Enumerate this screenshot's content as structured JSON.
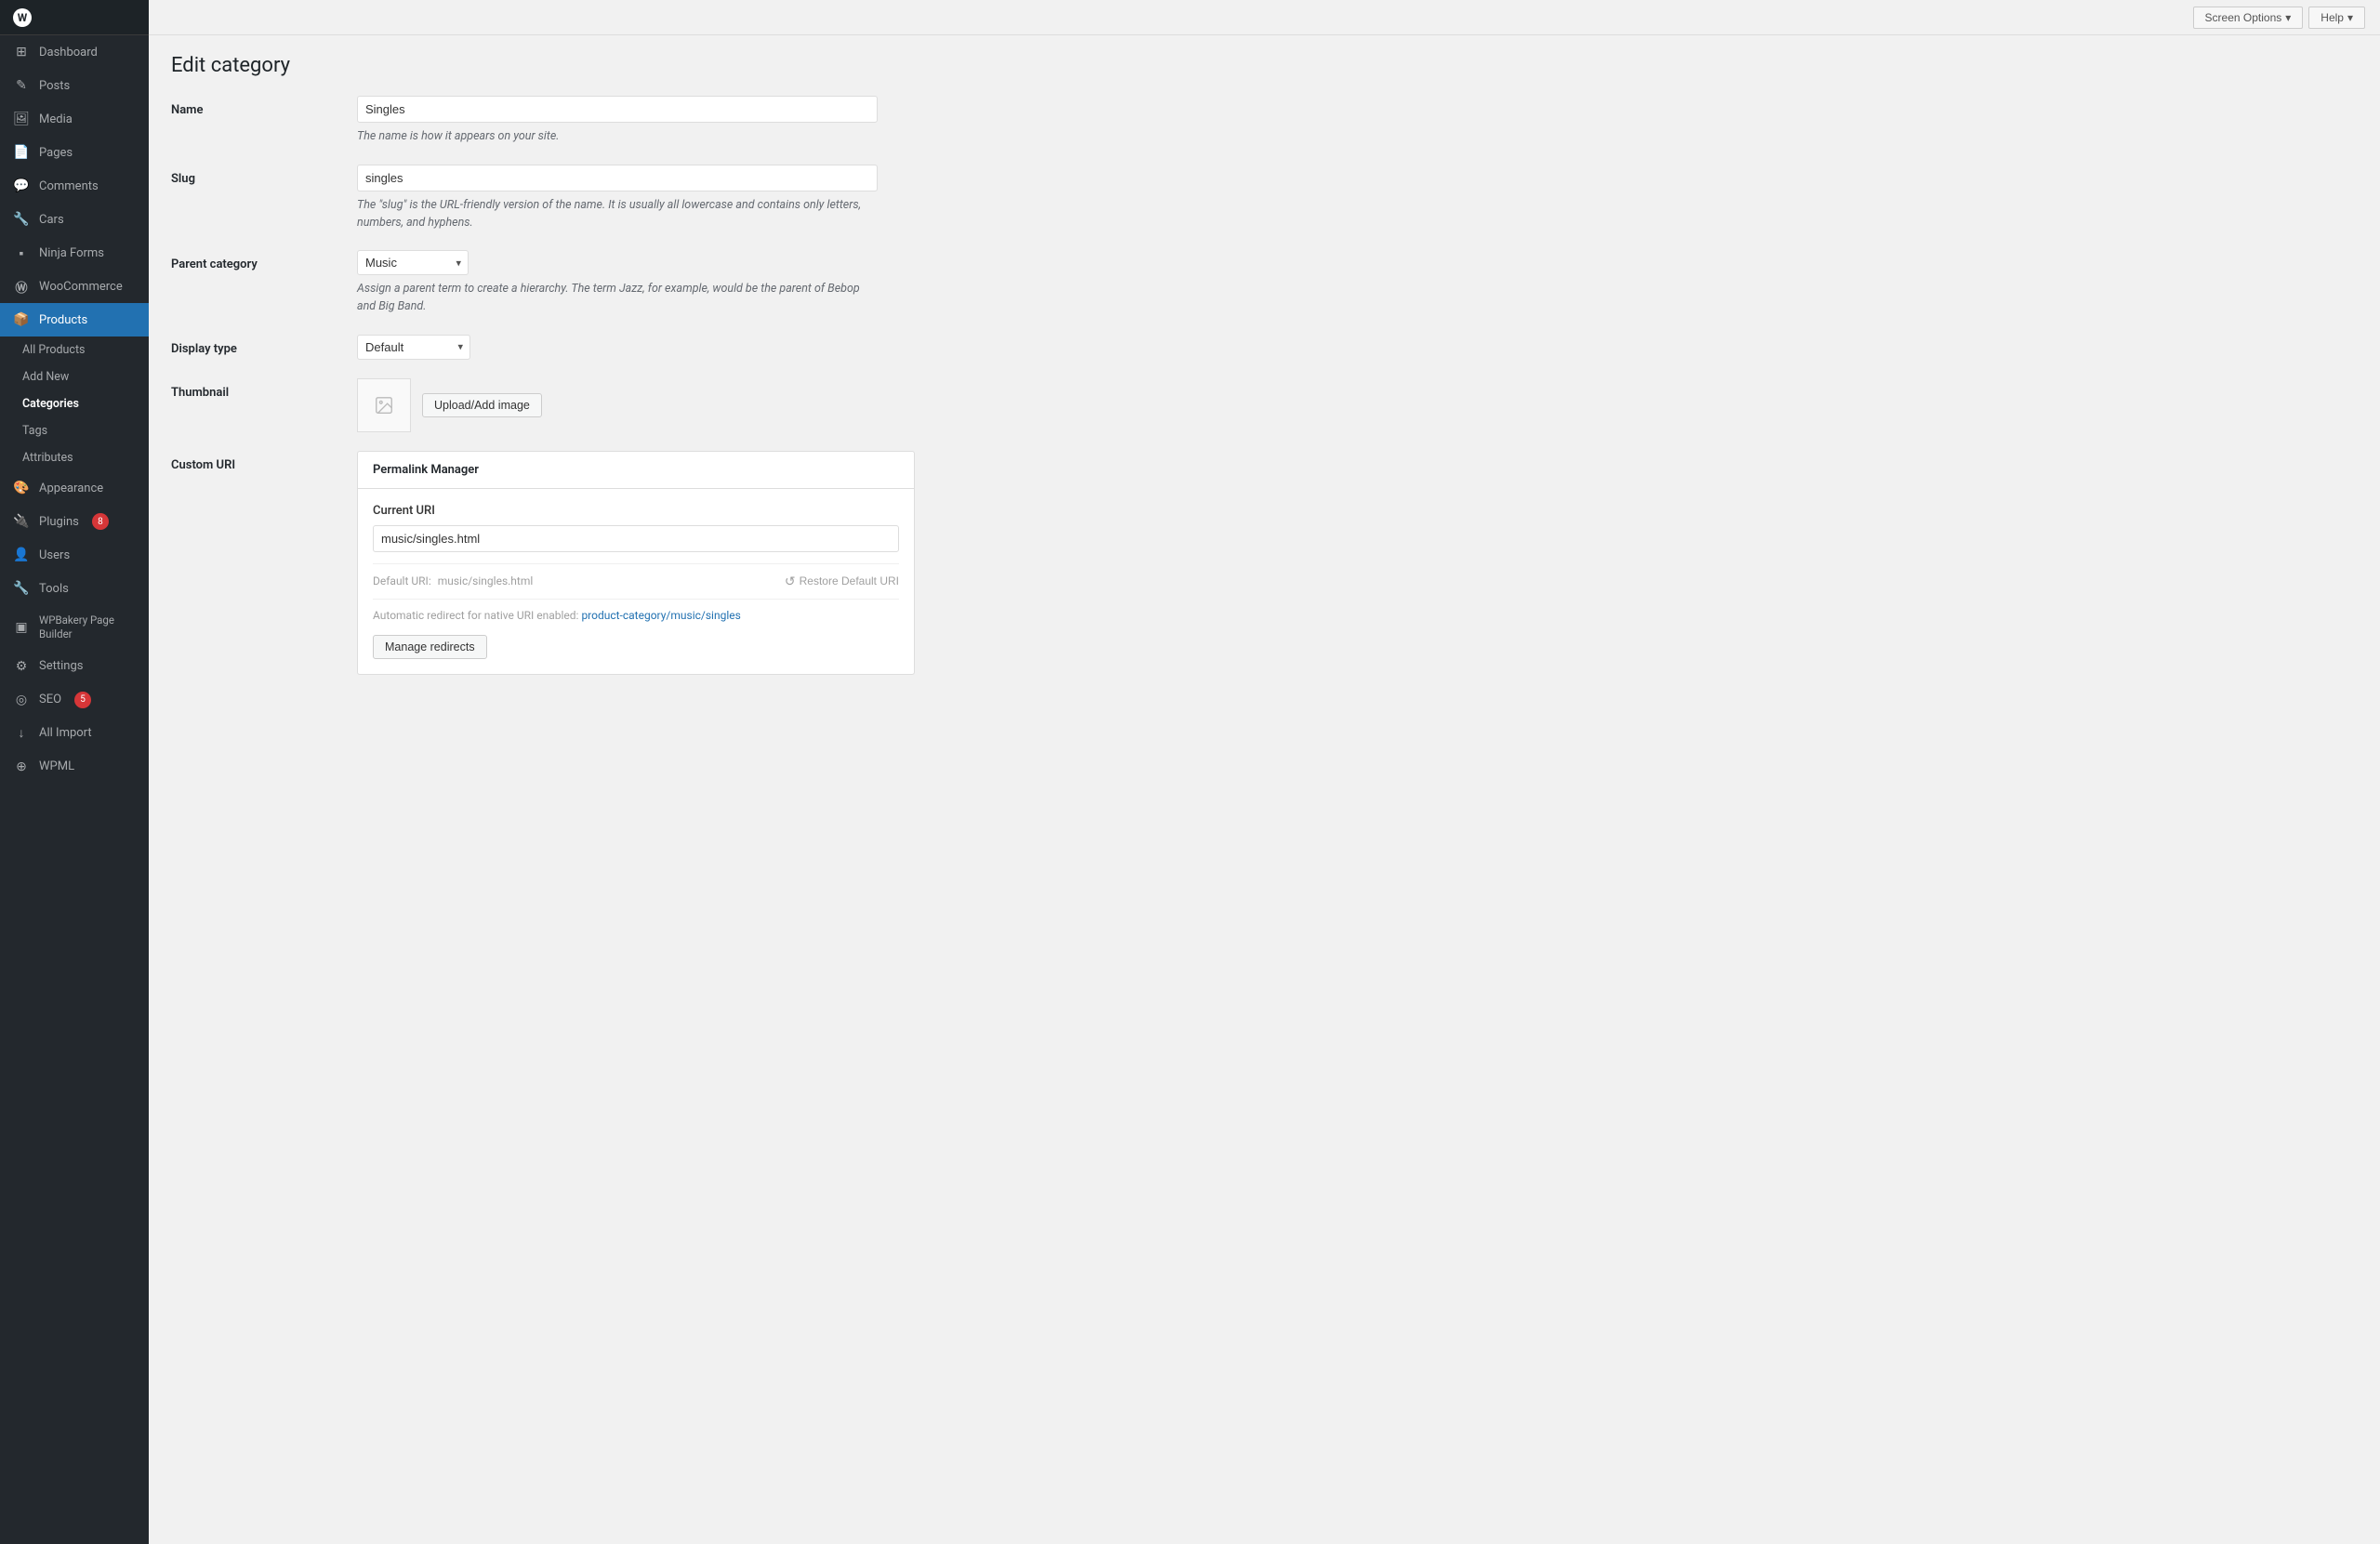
{
  "topbar": {
    "screen_options_label": "Screen Options",
    "help_label": "Help"
  },
  "sidebar": {
    "logo": "W",
    "items": [
      {
        "id": "dashboard",
        "label": "Dashboard",
        "icon": "⊞"
      },
      {
        "id": "posts",
        "label": "Posts",
        "icon": "✎"
      },
      {
        "id": "media",
        "label": "Media",
        "icon": "⊟"
      },
      {
        "id": "pages",
        "label": "Pages",
        "icon": "▬"
      },
      {
        "id": "comments",
        "label": "Comments",
        "icon": "💬"
      },
      {
        "id": "cars",
        "label": "Cars",
        "icon": "🔧"
      },
      {
        "id": "ninja-forms",
        "label": "Ninja Forms",
        "icon": "▪"
      },
      {
        "id": "woocommerce",
        "label": "WooCommerce",
        "icon": "Ⓦ"
      },
      {
        "id": "products",
        "label": "Products",
        "icon": "📦",
        "active": true
      },
      {
        "id": "appearance",
        "label": "Appearance",
        "icon": "🎨"
      },
      {
        "id": "plugins",
        "label": "Plugins",
        "icon": "🔌",
        "badge": "8"
      },
      {
        "id": "users",
        "label": "Users",
        "icon": "👤"
      },
      {
        "id": "tools",
        "label": "Tools",
        "icon": "🔧"
      },
      {
        "id": "wpbakery",
        "label": "WPBakery Page Builder",
        "icon": "▣"
      },
      {
        "id": "settings",
        "label": "Settings",
        "icon": "⚙"
      },
      {
        "id": "seo",
        "label": "SEO",
        "icon": "◎",
        "badge": "5"
      },
      {
        "id": "all-import",
        "label": "All Import",
        "icon": "↓"
      },
      {
        "id": "wpml",
        "label": "WPML",
        "icon": "⊕"
      }
    ],
    "subitems": [
      {
        "id": "all-products",
        "label": "All Products"
      },
      {
        "id": "add-new",
        "label": "Add New"
      },
      {
        "id": "categories",
        "label": "Categories",
        "active": true
      },
      {
        "id": "tags",
        "label": "Tags"
      },
      {
        "id": "attributes",
        "label": "Attributes"
      }
    ]
  },
  "page": {
    "title": "Edit category",
    "form": {
      "name_label": "Name",
      "name_value": "Singles",
      "name_hint": "The name is how it appears on your site.",
      "slug_label": "Slug",
      "slug_value": "singles",
      "slug_hint": "The \"slug\" is the URL-friendly version of the name. It is usually all lowercase and contains only letters, numbers, and hyphens.",
      "parent_label": "Parent category",
      "parent_value": "Music",
      "parent_hint": "Assign a parent term to create a hierarchy. The term Jazz, for example, would be the parent of Bebop and Big Band.",
      "display_label": "Display type",
      "display_value": "Default",
      "thumbnail_label": "Thumbnail",
      "upload_btn_label": "Upload/Add image",
      "custom_uri_label": "Custom URI"
    },
    "permalink": {
      "title": "Permalink Manager",
      "current_uri_label": "Current URI",
      "current_uri_value": "music/singles.html",
      "default_uri_label": "Default URI:",
      "default_uri_value": "music/singles.html",
      "restore_label": "Restore Default URI",
      "redirect_text": "Automatic redirect for native URI enabled:",
      "redirect_link_text": "product-category/music/singles",
      "manage_redirects_label": "Manage redirects"
    }
  }
}
